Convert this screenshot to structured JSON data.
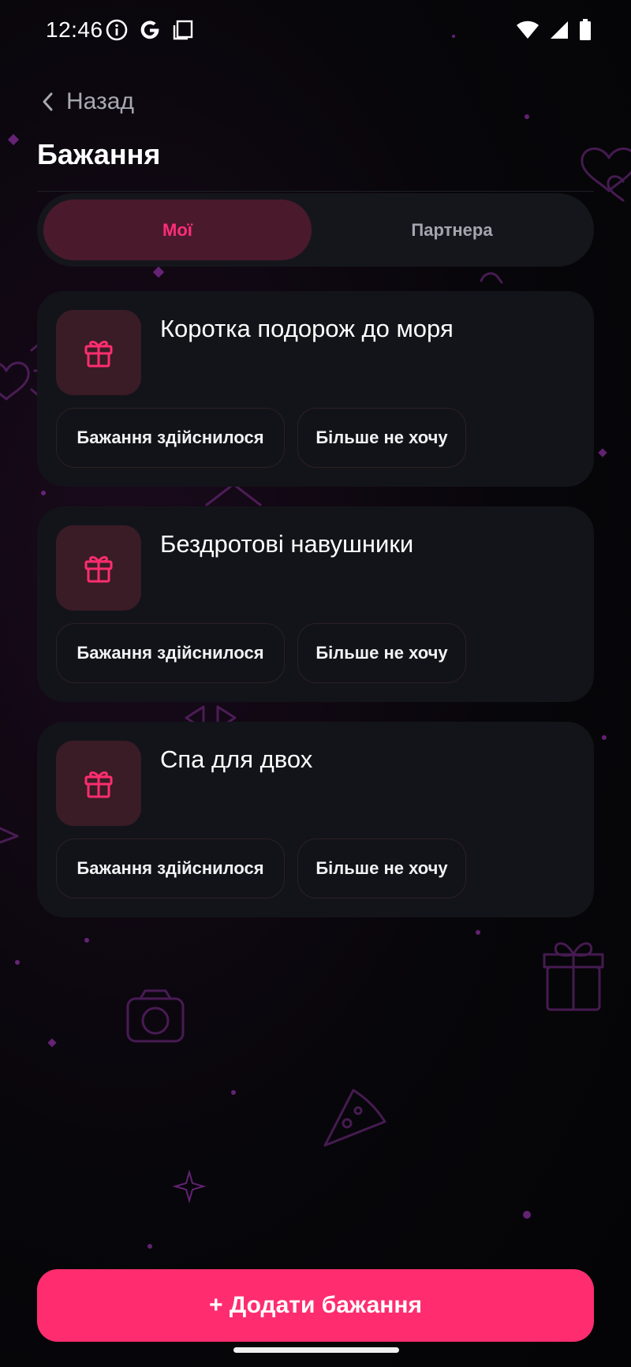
{
  "status_bar": {
    "time": "12:46",
    "left_icons": [
      "info-icon",
      "google-icon",
      "clipboard-icon"
    ],
    "right_icons": [
      "wifi-icon",
      "signal-icon",
      "battery-icon"
    ]
  },
  "header": {
    "back_label": "Назад",
    "title": "Бажання"
  },
  "tabs": {
    "active": "Мої",
    "inactive": "Партнера"
  },
  "wishes": [
    {
      "title": "Коротка подорож до моря",
      "icon": "gift-icon",
      "done_label": "Бажання здійснилося",
      "no_more_label": "Більше не хочу"
    },
    {
      "title": "Бездротові навушники",
      "icon": "gift-icon",
      "done_label": "Бажання здійснилося",
      "no_more_label": "Більше не хочу"
    },
    {
      "title": "Спа для двох",
      "icon": "gift-icon",
      "done_label": "Бажання здійснилося",
      "no_more_label": "Більше не хочу"
    }
  ],
  "add_button": {
    "label": "+ Додати бажання"
  },
  "colors": {
    "accent": "#ff2d6f",
    "active_tab_bg": "#4a1a2c",
    "card_bg": "#131419",
    "icon_tile_bg": "#3a1c26"
  }
}
